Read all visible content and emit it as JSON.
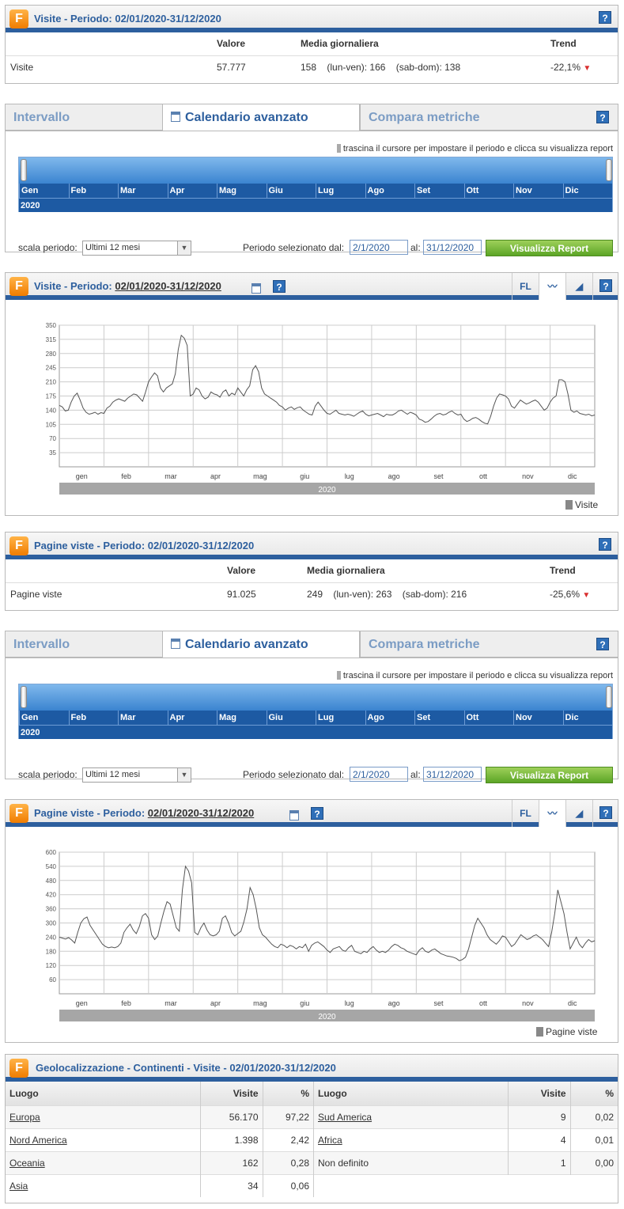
{
  "visits_summary": {
    "title": "Visite - Periodo: 02/01/2020-31/12/2020",
    "help": "?",
    "headers": {
      "value": "Valore",
      "avg": "Media giornaliera",
      "trend": "Trend"
    },
    "row": {
      "label": "Visite",
      "value": "57.777",
      "avg": "158",
      "weekdays": "(lun-ven): 166",
      "weekend": "(sab-dom): 138",
      "trend": "-22,1%"
    }
  },
  "pages_summary": {
    "title": "Pagine viste - Periodo: 02/01/2020-31/12/2020",
    "help": "?",
    "headers": {
      "value": "Valore",
      "avg": "Media giornaliera",
      "trend": "Trend"
    },
    "row": {
      "label": "Pagine viste",
      "value": "91.025",
      "avg": "249",
      "weekdays": "(lun-ven): 263",
      "weekend": "(sab-dom): 216",
      "trend": "-25,6%"
    }
  },
  "calendar": {
    "tabs": [
      "Intervallo",
      "Calendario avanzato",
      "Compara metriche"
    ],
    "active_tab": "Calendario avanzato",
    "help": "?",
    "slider_note": "trascina il cursore per impostare il periodo e clicca su visualizza report",
    "months": [
      "Gen",
      "Feb",
      "Mar",
      "Apr",
      "Mag",
      "Giu",
      "Lug",
      "Ago",
      "Set",
      "Ott",
      "Nov",
      "Dic"
    ],
    "year": "2020",
    "scale_label": "scala periodo:",
    "scale_value": "Ultimi 12 mesi",
    "period_label": "Periodo selezionato dal:",
    "from": "2/1/2020",
    "to_label": "al:",
    "to": "31/12/2020",
    "button": "Visualizza Report"
  },
  "visits_chart_panel": {
    "title_prefix": "Visite - Periodo:",
    "title_period": "02/01/2020-31/12/2020",
    "tools": {
      "fl": "FL"
    },
    "legend": "Visite"
  },
  "pages_chart_panel": {
    "title_prefix": "Pagine viste - Periodo:",
    "title_period": "02/01/2020-31/12/2020",
    "tools": {
      "fl": "FL"
    },
    "legend": "Pagine viste"
  },
  "chart_data": [
    {
      "type": "line",
      "title": "",
      "x_labels": [
        "gen",
        "feb",
        "mar",
        "apr",
        "mag",
        "giu",
        "lug",
        "ago",
        "set",
        "ott",
        "nov",
        "dic"
      ],
      "year_label": "2020",
      "yticks": [
        35,
        70,
        105,
        140,
        175,
        210,
        245,
        280,
        315,
        350
      ],
      "ylim": [
        0,
        350
      ],
      "grid": true,
      "legend_position": "bottom-right",
      "series": [
        {
          "name": "Visite",
          "color": "#555555",
          "values": [
            152,
            148,
            138,
            140,
            160,
            175,
            182,
            165,
            145,
            135,
            130,
            132,
            135,
            130,
            134,
            132,
            145,
            150,
            160,
            165,
            168,
            165,
            162,
            170,
            175,
            180,
            178,
            170,
            162,
            185,
            210,
            222,
            232,
            225,
            195,
            185,
            195,
            200,
            205,
            230,
            290,
            325,
            318,
            300,
            175,
            180,
            195,
            190,
            175,
            168,
            172,
            185,
            180,
            178,
            172,
            185,
            190,
            175,
            182,
            178,
            195,
            185,
            175,
            190,
            200,
            240,
            250,
            235,
            195,
            180,
            175,
            170,
            165,
            160,
            152,
            148,
            140,
            145,
            148,
            142,
            146,
            148,
            140,
            135,
            130,
            128,
            150,
            160,
            150,
            140,
            132,
            130,
            135,
            140,
            132,
            130,
            128,
            130,
            128,
            125,
            130,
            135,
            138,
            130,
            126,
            128,
            130,
            132,
            128,
            124,
            130,
            128,
            128,
            132,
            138,
            140,
            135,
            130,
            135,
            132,
            128,
            118,
            115,
            110,
            112,
            118,
            125,
            130,
            132,
            128,
            130,
            135,
            138,
            132,
            128,
            130,
            118,
            112,
            115,
            120,
            122,
            118,
            112,
            108,
            106,
            125,
            150,
            170,
            180,
            178,
            175,
            168,
            150,
            145,
            155,
            165,
            160,
            155,
            158,
            162,
            165,
            160,
            150,
            140,
            145,
            160,
            170,
            175,
            215,
            215,
            210,
            180,
            140,
            135,
            138,
            132,
            130,
            128,
            130,
            126,
            128
          ]
        }
      ]
    },
    {
      "type": "line",
      "title": "",
      "x_labels": [
        "gen",
        "feb",
        "mar",
        "apr",
        "mag",
        "giu",
        "lug",
        "ago",
        "set",
        "ott",
        "nov",
        "dic"
      ],
      "year_label": "2020",
      "yticks": [
        60,
        120,
        180,
        240,
        300,
        360,
        420,
        480,
        540,
        600
      ],
      "ylim": [
        0,
        600
      ],
      "grid": true,
      "legend_position": "bottom-right",
      "series": [
        {
          "name": "Pagine viste",
          "color": "#555555",
          "values": [
            240,
            236,
            232,
            238,
            228,
            215,
            260,
            300,
            318,
            325,
            290,
            270,
            250,
            230,
            210,
            200,
            195,
            198,
            195,
            200,
            215,
            260,
            280,
            295,
            270,
            255,
            285,
            330,
            340,
            320,
            250,
            230,
            245,
            300,
            350,
            390,
            380,
            330,
            280,
            265,
            440,
            540,
            520,
            470,
            260,
            250,
            280,
            300,
            270,
            250,
            245,
            250,
            265,
            320,
            330,
            300,
            260,
            245,
            255,
            265,
            305,
            360,
            450,
            420,
            360,
            280,
            250,
            240,
            225,
            210,
            200,
            195,
            210,
            205,
            195,
            205,
            200,
            190,
            200,
            195,
            210,
            180,
            205,
            215,
            220,
            210,
            200,
            185,
            175,
            190,
            195,
            200,
            185,
            180,
            195,
            205,
            180,
            175,
            170,
            180,
            175,
            190,
            200,
            185,
            175,
            180,
            175,
            185,
            200,
            210,
            205,
            195,
            190,
            180,
            175,
            170,
            165,
            185,
            195,
            180,
            175,
            185,
            190,
            180,
            170,
            165,
            160,
            158,
            155,
            150,
            140,
            145,
            155,
            190,
            240,
            290,
            320,
            300,
            280,
            250,
            230,
            220,
            210,
            225,
            245,
            240,
            220,
            200,
            210,
            230,
            250,
            240,
            230,
            235,
            245,
            250,
            240,
            230,
            215,
            200,
            260,
            340,
            440,
            390,
            340,
            260,
            190,
            215,
            240,
            210,
            195,
            215,
            230,
            220,
            225
          ]
        }
      ]
    }
  ],
  "geo": {
    "title": "Geolocalizzazione - Continenti - Visite - 02/01/2020-31/12/2020",
    "headers": {
      "place": "Luogo",
      "visits": "Visite",
      "pct": "%"
    },
    "left": [
      {
        "place": "Europa",
        "visits": "56.170",
        "pct": "97,22",
        "link": true
      },
      {
        "place": "Nord America",
        "visits": "1.398",
        "pct": "2,42",
        "link": true
      },
      {
        "place": "Oceania",
        "visits": "162",
        "pct": "0,28",
        "link": true
      },
      {
        "place": "Asia",
        "visits": "34",
        "pct": "0,06",
        "link": true
      }
    ],
    "right": [
      {
        "place": "Sud America",
        "visits": "9",
        "pct": "0,02",
        "link": true
      },
      {
        "place": "Africa",
        "visits": "4",
        "pct": "0,01",
        "link": true
      },
      {
        "place": "Non definito",
        "visits": "1",
        "pct": "0,00",
        "link": false
      }
    ]
  }
}
